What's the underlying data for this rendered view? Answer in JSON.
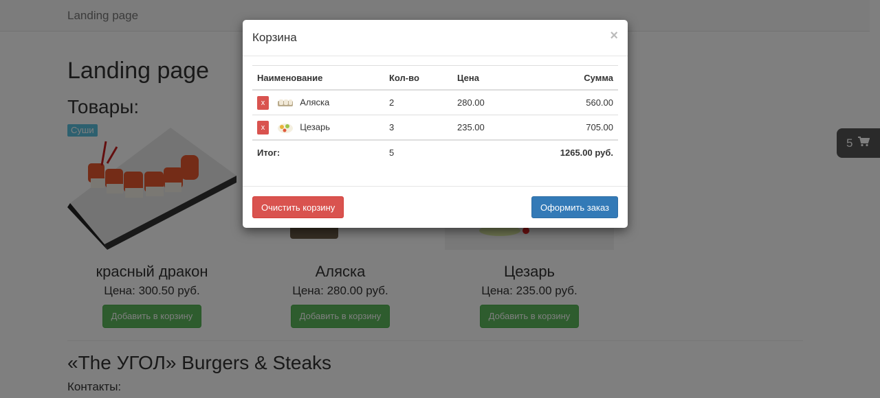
{
  "navbar": {
    "brand": "Landing page"
  },
  "page": {
    "title": "Landing page",
    "products_heading": "Товары:",
    "category_label": "Суши",
    "products": [
      {
        "name": "красный дракон",
        "price": "Цена: 300.50 руб.",
        "button": "Добавить в корзину"
      },
      {
        "name": "Аляска",
        "price": "Цена: 280.00 руб.",
        "button": "Добавить в корзину"
      },
      {
        "name": "Цезарь",
        "price": "Цена: 235.00 руб.",
        "button": "Добавить в корзину"
      }
    ],
    "restaurant_heading": "«The УГОЛ» Burgers & Steaks",
    "contacts_label": "Контакты:"
  },
  "cart_badge": {
    "count": "5",
    "icon": "shopping-cart-icon"
  },
  "modal": {
    "title": "Корзина",
    "close": "×",
    "columns": {
      "name": "Наименование",
      "qty": "Кол-во",
      "price": "Цена",
      "sum": "Сумма"
    },
    "rows": [
      {
        "remove": "x",
        "name": "Аляска",
        "qty": "2",
        "price": "280.00",
        "sum": "560.00"
      },
      {
        "remove": "x",
        "name": "Цезарь",
        "qty": "3",
        "price": "235.00",
        "sum": "705.00"
      }
    ],
    "total": {
      "label": "Итог:",
      "qty": "5",
      "sum": "1265.00 руб."
    },
    "clear_button": "Очистить корзину",
    "order_button": "Оформить заказ"
  },
  "colors": {
    "danger": "#d9534f",
    "primary": "#337ab7",
    "success": "#5cb85c",
    "info": "#5bc0de",
    "backdrop": "rgba(0,0,0,0.5)"
  }
}
